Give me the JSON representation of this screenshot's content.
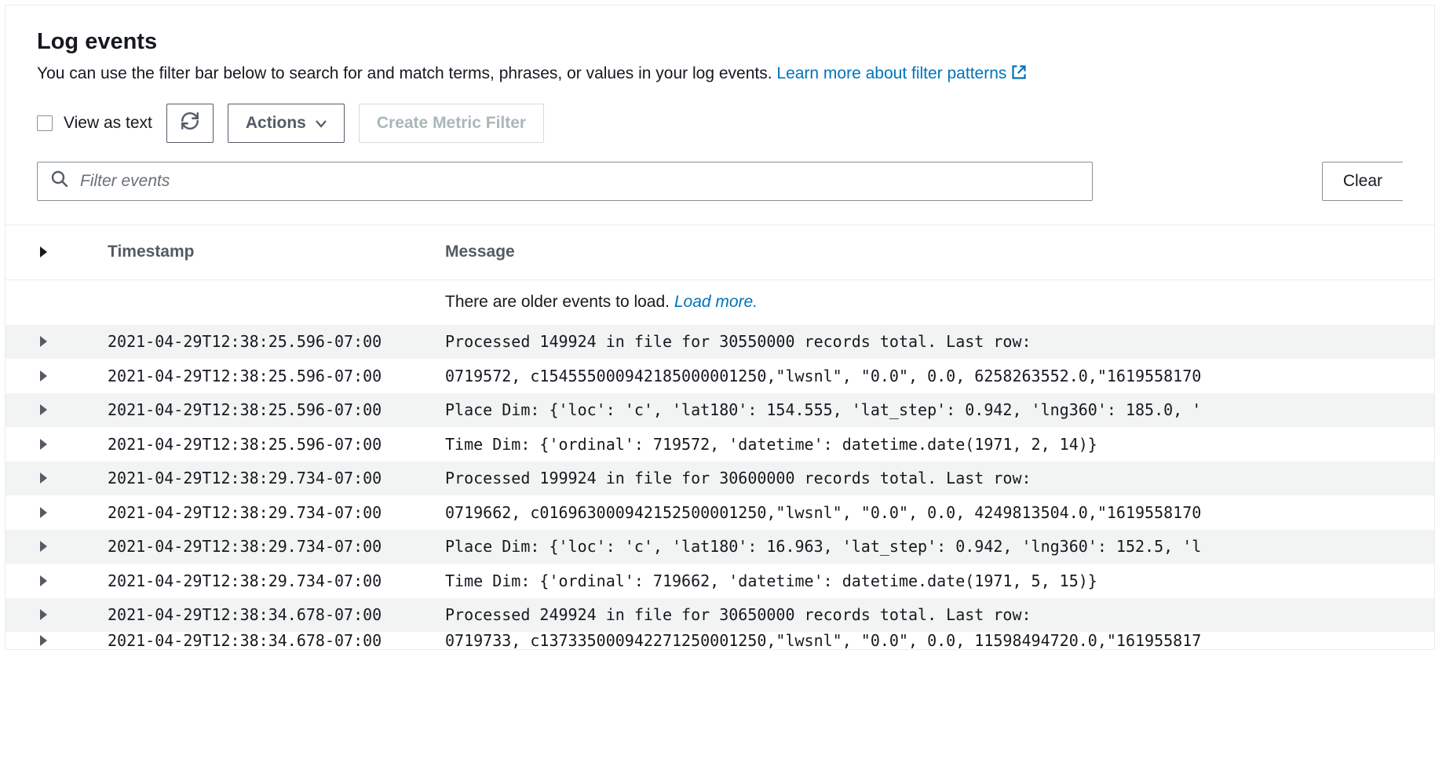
{
  "header": {
    "title": "Log events",
    "subtitle_pre": "You can use the filter bar below to search for and match terms, phrases, or values in your log events. ",
    "learn_link": "Learn more about filter patterns"
  },
  "toolbar": {
    "view_as_text_label": "View as text",
    "actions_label": "Actions",
    "create_metric_label": "Create Metric Filter"
  },
  "filter": {
    "placeholder": "Filter events",
    "clear_label": "Clear"
  },
  "table": {
    "col_timestamp": "Timestamp",
    "col_message": "Message",
    "older_events_text": "There are older events to load. ",
    "load_more_label": "Load more.",
    "rows": [
      {
        "ts": "2021-04-29T12:38:25.596-07:00",
        "msg": "Processed 149924 in file for 30550000 records total. Last row:"
      },
      {
        "ts": "2021-04-29T12:38:25.596-07:00",
        "msg": "0719572, c154555000942185000001250,\"lwsnl\", \"0.0\", 0.0, 6258263552.0,\"1619558170"
      },
      {
        "ts": "2021-04-29T12:38:25.596-07:00",
        "msg": "Place Dim: {'loc': 'c', 'lat180': 154.555, 'lat_step': 0.942, 'lng360': 185.0, '"
      },
      {
        "ts": "2021-04-29T12:38:25.596-07:00",
        "msg": "Time Dim: {'ordinal': 719572, 'datetime': datetime.date(1971, 2, 14)}"
      },
      {
        "ts": "2021-04-29T12:38:29.734-07:00",
        "msg": "Processed 199924 in file for 30600000 records total. Last row:"
      },
      {
        "ts": "2021-04-29T12:38:29.734-07:00",
        "msg": "0719662, c016963000942152500001250,\"lwsnl\", \"0.0\", 0.0, 4249813504.0,\"1619558170"
      },
      {
        "ts": "2021-04-29T12:38:29.734-07:00",
        "msg": "Place Dim: {'loc': 'c', 'lat180': 16.963, 'lat_step': 0.942, 'lng360': 152.5, 'l"
      },
      {
        "ts": "2021-04-29T12:38:29.734-07:00",
        "msg": "Time Dim: {'ordinal': 719662, 'datetime': datetime.date(1971, 5, 15)}"
      },
      {
        "ts": "2021-04-29T12:38:34.678-07:00",
        "msg": "Processed 249924 in file for 30650000 records total. Last row:"
      },
      {
        "ts": "2021-04-29T12:38:34.678-07:00",
        "msg": "0719733, c137335000942271250001250,\"lwsnl\", \"0.0\", 0.0, 11598494720.0,\"161955817"
      }
    ]
  }
}
